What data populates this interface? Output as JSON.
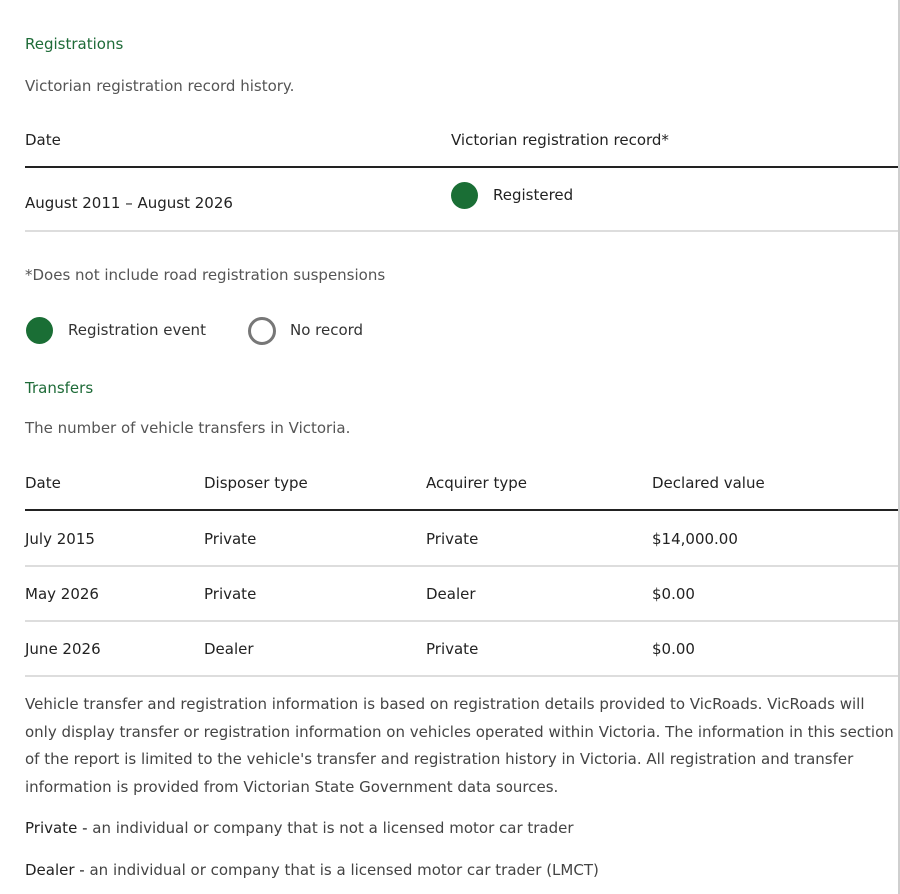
{
  "registrations": {
    "title": "Registrations",
    "description": "Victorian registration record history.",
    "columns": [
      "Date",
      "Victorian registration record*"
    ],
    "row": {
      "date": "August 2011 – August 2026",
      "status": "Registered"
    },
    "footnote": "*Does not include road registration suspensions",
    "legend": [
      {
        "label": "Registration event",
        "style": "filled"
      },
      {
        "label": "No record",
        "style": "empty"
      }
    ]
  },
  "transfers": {
    "title": "Transfers",
    "description": "The number of vehicle transfers in Victoria.",
    "columns": [
      "Date",
      "Disposer type",
      "Acquirer type",
      "Declared value"
    ],
    "rows": [
      [
        "July 2015",
        "Private",
        "Private",
        "$14,000.00"
      ],
      [
        "May 2026",
        "Private",
        "Dealer",
        "$0.00"
      ],
      [
        "June 2026",
        "Dealer",
        "Private",
        "$0.00"
      ]
    ]
  },
  "info_paragraph": "Vehicle transfer and registration information is based on registration details provided to VicRoads. VicRoads will only display transfer or registration information on vehicles operated within Victoria. The information in this section of the report is limited to the vehicle's transfer and registration history in Victoria. All registration and transfer information is provided from Victorian State Government data sources.",
  "definitions": {
    "private_term": "Private - ",
    "private_text": "an individual or company that is not a licensed motor car trader",
    "dealer_term": "Dealer - ",
    "dealer_text": "an individual or company that is a licensed motor car trader (LMCT)"
  },
  "colors": {
    "accent": "#1e6b38",
    "dot": "#1a6e35"
  }
}
